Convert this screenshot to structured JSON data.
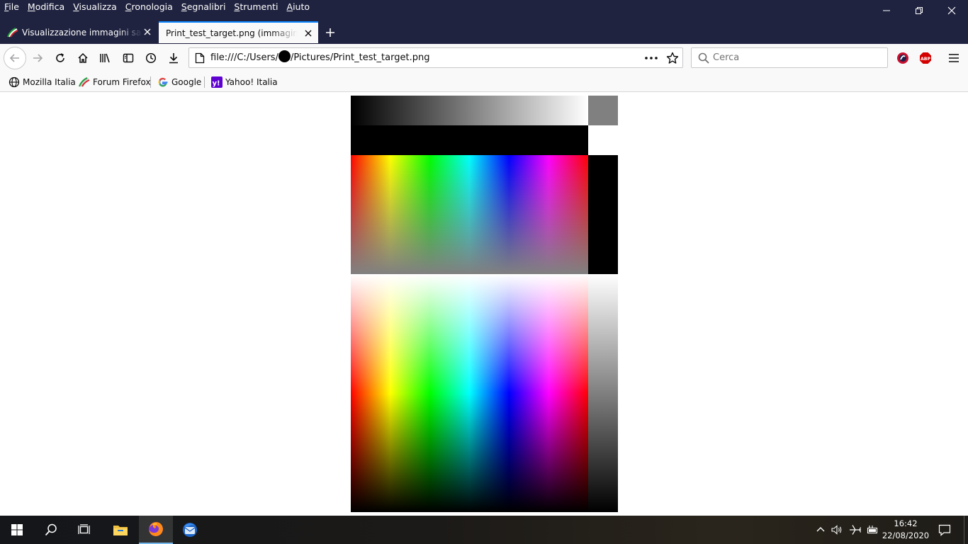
{
  "menu": {
    "items": [
      "File",
      "Modifica",
      "Visualizza",
      "Cronologia",
      "Segnalibri",
      "Strumenti",
      "Aiuto"
    ]
  },
  "tabs": [
    {
      "title": "Visualizzazione immagini salvate",
      "active": false
    },
    {
      "title": "Print_test_target.png (immagine PNG",
      "active": true
    }
  ],
  "toolbar": {
    "url_prefix": "file:///C:/Users/",
    "url_suffix": "/Pictures/Print_test_target.png",
    "search_placeholder": "Cerca"
  },
  "bookmarks": [
    {
      "label": "Mozilla Italia",
      "icon": "globe-icon"
    },
    {
      "label": "Forum Firefox",
      "icon": "italia-flag-icon"
    },
    {
      "label": "Google",
      "icon": "google-icon"
    },
    {
      "label": "Yahoo! Italia",
      "icon": "yahoo-icon"
    }
  ],
  "taskbar": {
    "time": "16:42",
    "date": "22/08/2020",
    "apps": [
      "start-icon",
      "search-icon",
      "task-view-icon",
      "file-explorer-icon",
      "firefox-icon",
      "thunderbird-icon"
    ]
  },
  "colors": {
    "titlebar": "#202340",
    "toolbar": "#f9f9fa",
    "tab_accent": "#0a84ff"
  }
}
